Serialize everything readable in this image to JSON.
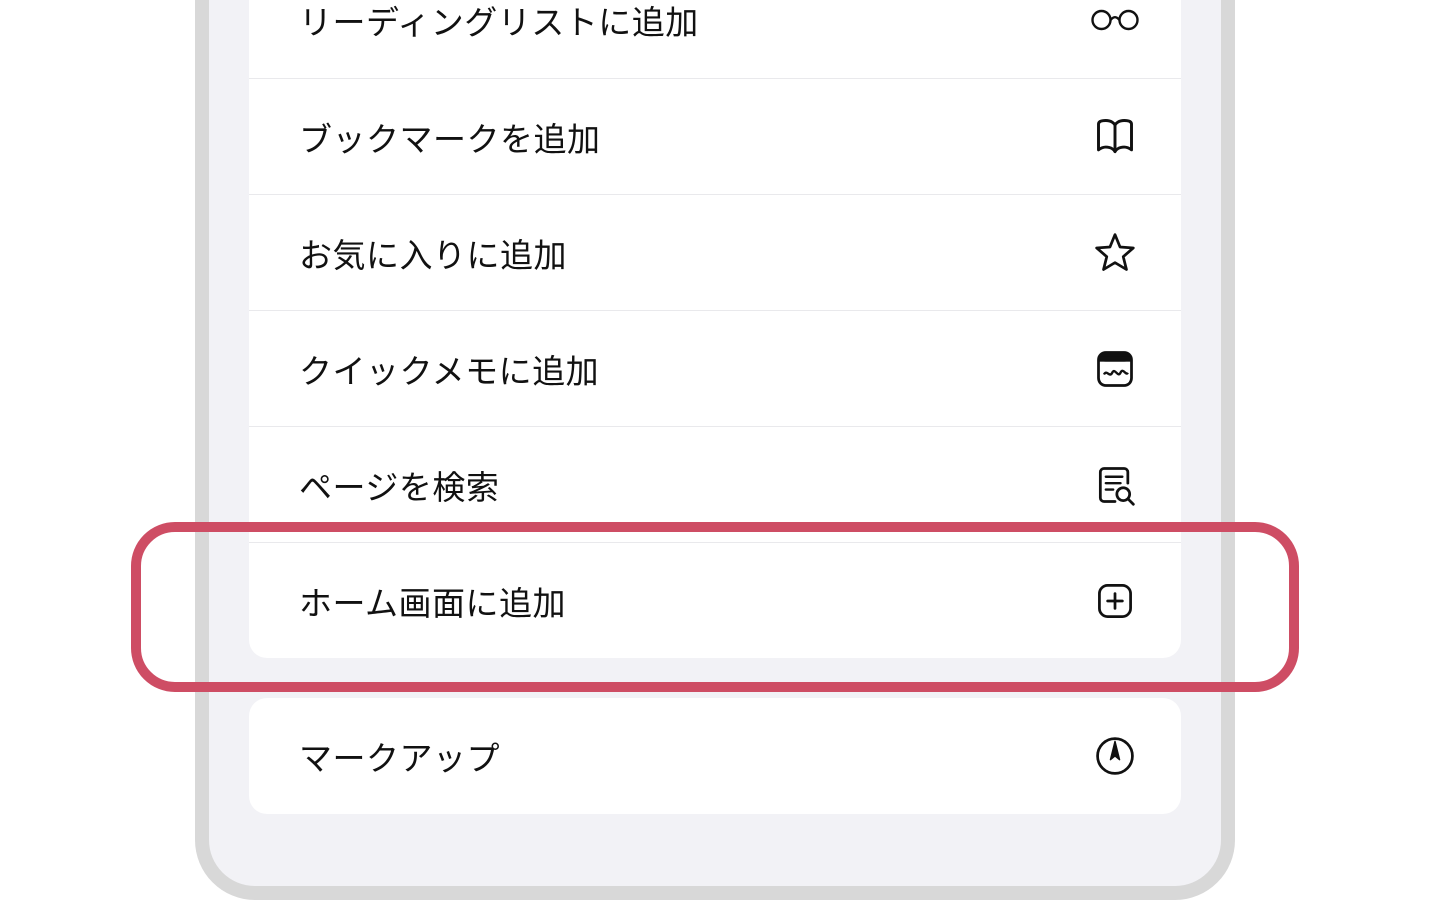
{
  "menu": {
    "group1": [
      {
        "label": "リーディングリストに追加",
        "icon": "glasses-icon"
      },
      {
        "label": "ブックマークを追加",
        "icon": "book-icon"
      },
      {
        "label": "お気に入りに追加",
        "icon": "star-icon"
      },
      {
        "label": "クイックメモに追加",
        "icon": "quicknote-icon"
      },
      {
        "label": "ページを検索",
        "icon": "find-on-page-icon"
      },
      {
        "label": "ホーム画面に追加",
        "icon": "plus-square-icon"
      }
    ],
    "group2": [
      {
        "label": "マークアップ",
        "icon": "markup-icon"
      }
    ]
  },
  "highlight_color": "#ce4d64"
}
